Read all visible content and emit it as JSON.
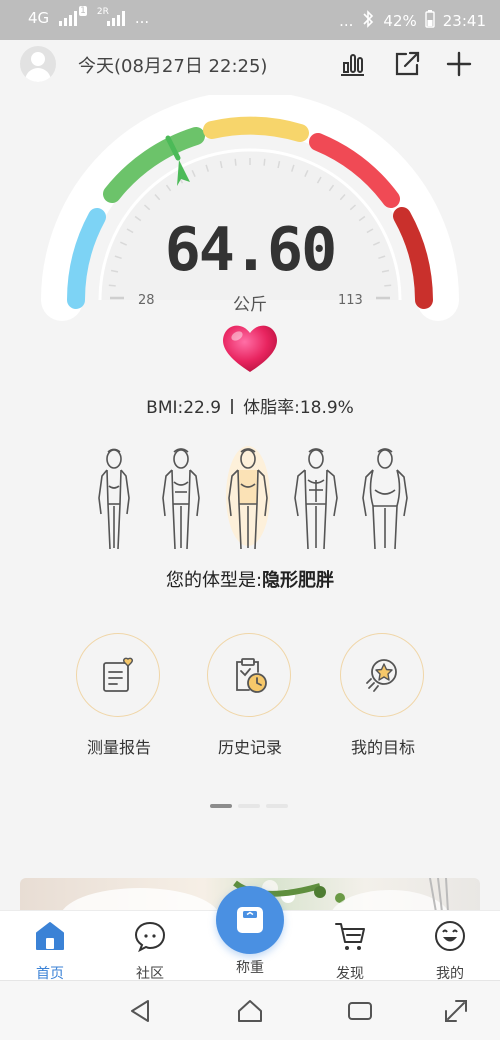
{
  "status_bar": {
    "network": "4G",
    "sim_badge": "1",
    "signal2_label": "2R",
    "left_dots": "...",
    "right_dots": "...",
    "battery": "42%",
    "time": "23:41"
  },
  "header": {
    "date_label": "今天(08月27日 22:25)",
    "icons": [
      "avatar",
      "bar-chart-icon",
      "share-icon",
      "plus-icon"
    ]
  },
  "gauge": {
    "weight": "64.60",
    "unit": "公斤",
    "min": "28",
    "max": "113",
    "level": 0.33,
    "colors": {
      "low": "#7dd3f5",
      "normal": "#6cc36a",
      "over": "#f7d56b",
      "obese": "#f04a55",
      "severe": "#c9302c",
      "pointer": "#4cba58"
    }
  },
  "stats": {
    "bmi": "BMI:22.9",
    "body_fat": "体脂率:18.9%"
  },
  "body_type": {
    "prefix": "您的体型是:",
    "value": "隐形肥胖",
    "figures": [
      "thin",
      "standard",
      "hidden-obese",
      "muscular",
      "obese"
    ],
    "active_index": 2
  },
  "actions": [
    {
      "label": "测量报告",
      "icon": "report-icon"
    },
    {
      "label": "历史记录",
      "icon": "history-icon"
    },
    {
      "label": "我的目标",
      "icon": "goal-icon"
    }
  ],
  "pager": {
    "active": 0,
    "count": 3
  },
  "tabs": [
    {
      "label": "首页",
      "icon": "home-icon",
      "active": true
    },
    {
      "label": "社区",
      "icon": "chat-icon",
      "active": false
    },
    {
      "label": "称重",
      "icon": "scale-icon",
      "active": false
    },
    {
      "label": "发现",
      "icon": "cart-icon",
      "active": false
    },
    {
      "label": "我的",
      "icon": "smile-icon",
      "active": false
    }
  ],
  "accent_color": "#4a90e2"
}
